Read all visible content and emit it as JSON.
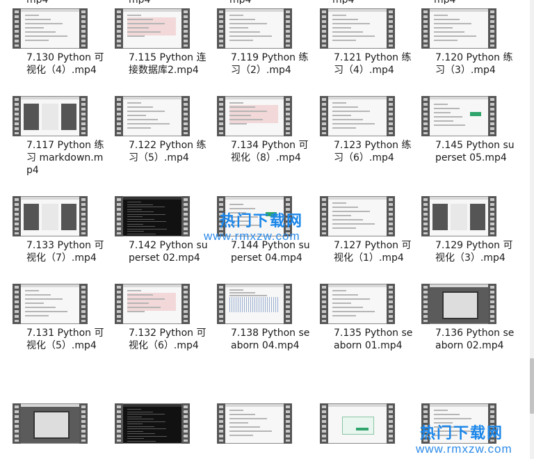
{
  "watermark": {
    "center_title": "热门下载网",
    "center_url": "www.rmxzw.com",
    "corner_title": "热门下载网",
    "corner_url": "www.rmxzw.com"
  },
  "top_fragments": [
    "mp4",
    "mp4",
    "mp4",
    "mp4",
    "mp4"
  ],
  "files": [
    {
      "label": "7.130 Python 可视化（4）.mp4",
      "thumb": "light"
    },
    {
      "label": "7.115 Python 连接数据库2.mp4",
      "thumb": "pink"
    },
    {
      "label": "7.119 Python 练习（2）.mp4",
      "thumb": "light"
    },
    {
      "label": "7.121 Python 练习（4）.mp4",
      "thumb": "light"
    },
    {
      "label": "7.120 Python 练习（3）.mp4",
      "thumb": "light"
    },
    {
      "label": "7.117 Python 练习 markdown.mp4",
      "thumb": "panels"
    },
    {
      "label": "7.122 Python 练习（5）.mp4",
      "thumb": "light"
    },
    {
      "label": "7.134 Python 可视化（8）.mp4",
      "thumb": "pink"
    },
    {
      "label": "7.123 Python 练习（6）.mp4",
      "thumb": "light"
    },
    {
      "label": "7.145 Python superset 05.mp4",
      "thumb": "green"
    },
    {
      "label": "7.133 Python 可视化（7）.mp4",
      "thumb": "panels"
    },
    {
      "label": "7.142 Python superset 02.mp4",
      "thumb": "dark"
    },
    {
      "label": "7.144 Python superset 04.mp4",
      "thumb": "green"
    },
    {
      "label": "7.127 Python 可视化（1）.mp4",
      "thumb": "light"
    },
    {
      "label": "7.129 Python 可视化（3）.mp4",
      "thumb": "panels"
    },
    {
      "label": "7.131 Python 可视化（5）.mp4",
      "thumb": "light"
    },
    {
      "label": "7.132 Python 可视化（6）.mp4",
      "thumb": "pink"
    },
    {
      "label": "7.138 Python seaborn 04.mp4",
      "thumb": "wave"
    },
    {
      "label": "7.135 Python seaborn 01.mp4",
      "thumb": "light"
    },
    {
      "label": "7.136 Python seaborn 02.mp4",
      "thumb": "gray"
    },
    {
      "label": "",
      "thumb": "gray"
    },
    {
      "label": "",
      "thumb": "dark"
    },
    {
      "label": "",
      "thumb": "light"
    },
    {
      "label": "",
      "thumb": "greenbox"
    },
    {
      "label": "",
      "thumb": "light"
    }
  ]
}
